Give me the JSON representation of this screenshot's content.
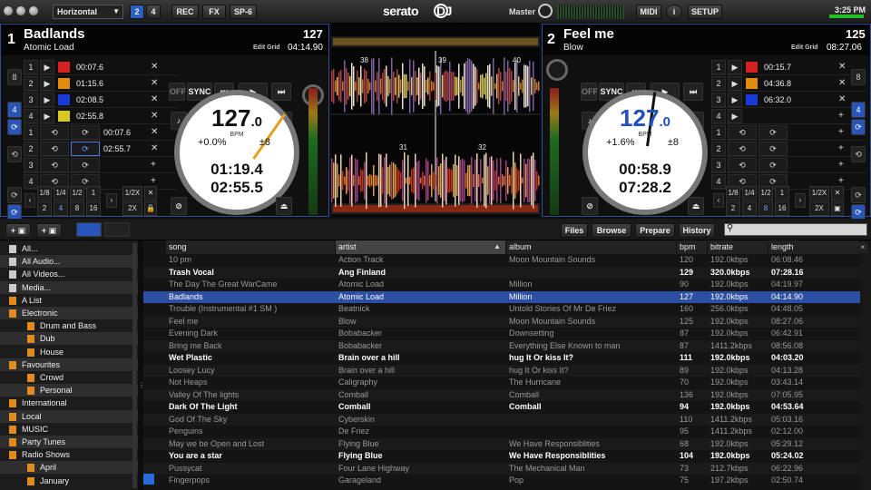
{
  "topbar": {
    "layout": "Horizontal",
    "deck_btns": [
      "2",
      "4"
    ],
    "buttons": [
      "REC",
      "FX",
      "SP-6"
    ],
    "logo": "serato",
    "logo_dj": "DJ",
    "master_label": "Master",
    "right_buttons": [
      "MIDI",
      "i",
      "SETUP"
    ],
    "clock": "3:25 PM"
  },
  "deck1": {
    "num": "1",
    "title": "Badlands",
    "artist": "Atomic Load",
    "bpm": "127",
    "time": "04:14.90",
    "edit_grid": "Edit Grid",
    "bpm_big": "127",
    "bpm_dec": ".0",
    "bpm_label": "BPM",
    "pitch": "+0.0%",
    "range": "±8",
    "elapsed": "01:19.4",
    "remain": "02:55.5",
    "side_labels": [
      "8",
      "4"
    ],
    "cues": [
      {
        "n": "1",
        "time": "00:07.6",
        "color": "#d42020"
      },
      {
        "n": "2",
        "time": "01:15.6",
        "color": "#e08a10"
      },
      {
        "n": "3",
        "time": "02:08.5",
        "color": "#1a3ad8"
      },
      {
        "n": "4",
        "time": "02:55.8",
        "color": "#d8c820"
      }
    ],
    "loops": [
      {
        "n": "1",
        "time": "00:07.6"
      },
      {
        "n": "2",
        "time": "02:55.7"
      },
      {
        "n": "3",
        "time": ""
      },
      {
        "n": "4",
        "time": ""
      }
    ],
    "controls": [
      "OFF",
      "SYNC"
    ],
    "loop_sizes_top": [
      "1/8",
      "1/4",
      "1/2",
      "1",
      "1/2X"
    ],
    "loop_sizes_bottom": [
      "2",
      "4",
      "8",
      "16",
      "2X"
    ]
  },
  "deck2": {
    "num": "2",
    "title": "Feel me",
    "artist": "Blow",
    "bpm": "125",
    "time": "08:27.06",
    "edit_grid": "Edit Grid",
    "bpm_big": "127",
    "bpm_dec": ".0",
    "bpm_label": "BPM",
    "pitch": "+1.6%",
    "range": "±8",
    "elapsed": "00:58.9",
    "remain": "07:28.2",
    "side_labels": [
      "8",
      "4"
    ],
    "cues": [
      {
        "n": "1",
        "time": "00:15.7",
        "color": "#d42020"
      },
      {
        "n": "2",
        "time": "04:36.8",
        "color": "#e08a10"
      },
      {
        "n": "3",
        "time": "06:32.0",
        "color": "#1a3ad8"
      },
      {
        "n": "4",
        "time": "",
        "color": ""
      }
    ],
    "loops": [
      {
        "n": "1",
        "time": ""
      },
      {
        "n": "2",
        "time": ""
      },
      {
        "n": "3",
        "time": ""
      },
      {
        "n": "4",
        "time": ""
      }
    ],
    "controls": [
      "OFF",
      "SYNC"
    ],
    "loop_sizes_top": [
      "1/8",
      "1/4",
      "1/2",
      "1",
      "1/2X"
    ],
    "loop_sizes_bottom": [
      "2",
      "4",
      "8",
      "16",
      "2X"
    ]
  },
  "waveform": {
    "markers": [
      "38",
      "39",
      "40",
      "31",
      "32"
    ]
  },
  "library": {
    "tabs": [
      "Files",
      "Browse",
      "Prepare",
      "History"
    ],
    "search_placeholder": "",
    "close": "×"
  },
  "sidebar": {
    "items": [
      {
        "label": "All...",
        "indent": 0,
        "icon": "gear-icon"
      },
      {
        "label": "All Audio...",
        "indent": 0,
        "icon": "audio-icon"
      },
      {
        "label": "All Videos...",
        "indent": 0,
        "icon": "video-icon"
      },
      {
        "label": "Media...",
        "indent": 0,
        "icon": "media-icon"
      },
      {
        "label": "A List",
        "indent": 0,
        "icon": "crate-icon"
      },
      {
        "label": "Electronic",
        "indent": 0,
        "icon": "crate-open-icon"
      },
      {
        "label": "Drum and Bass",
        "indent": 2,
        "icon": "crate-icon"
      },
      {
        "label": "Dub",
        "indent": 2,
        "icon": "crate-icon"
      },
      {
        "label": "House",
        "indent": 2,
        "icon": "crate-icon"
      },
      {
        "label": "Favourites",
        "indent": 0,
        "icon": "crate-open-icon"
      },
      {
        "label": "Crowd",
        "indent": 2,
        "icon": "crate-icon"
      },
      {
        "label": "Personal",
        "indent": 2,
        "icon": "crate-icon"
      },
      {
        "label": "International",
        "indent": 0,
        "icon": "crate-icon"
      },
      {
        "label": "Local",
        "indent": 0,
        "icon": "crate-icon"
      },
      {
        "label": "MUSIC",
        "indent": 0,
        "icon": "crate-icon"
      },
      {
        "label": "Party Tunes",
        "indent": 0,
        "icon": "crate-icon"
      },
      {
        "label": "Radio Shows",
        "indent": 0,
        "icon": "crate-open-icon"
      },
      {
        "label": "April",
        "indent": 2,
        "icon": "crate-icon"
      },
      {
        "label": "January",
        "indent": 2,
        "icon": "crate-icon"
      }
    ]
  },
  "table": {
    "columns": [
      "song",
      "artist",
      "album",
      "bpm",
      "bitrate",
      "length"
    ],
    "rows": [
      {
        "song": "10 pm",
        "artist": "Action Track",
        "album": "Moon Mountain Sounds",
        "bpm": "120",
        "bitrate": "192.0kbps",
        "length": "06:08.46",
        "style": ""
      },
      {
        "song": "Trash Vocal",
        "artist": "Ang Finland",
        "album": "",
        "bpm": "129",
        "bitrate": "320.0kbps",
        "length": "07:28.16",
        "style": "bold"
      },
      {
        "song": "The Day The Great WarCame",
        "artist": "Atomic Load",
        "album": "Million",
        "bpm": "90",
        "bitrate": "192.0kbps",
        "length": "04:19.97",
        "style": ""
      },
      {
        "song": "Badlands",
        "artist": "Atomic Load",
        "album": "Million",
        "bpm": "127",
        "bitrate": "192.0kbps",
        "length": "04:14.90",
        "style": "sel"
      },
      {
        "song": "Trouble (Instrumental #1 SM )",
        "artist": "Beatnick",
        "album": "Untold Stories Of Mr De Friez",
        "bpm": "160",
        "bitrate": "256.0kbps",
        "length": "04:48.05",
        "style": ""
      },
      {
        "song": "Feel me",
        "artist": "Blow",
        "album": "Moon Mountain Sounds",
        "bpm": "125",
        "bitrate": "192.0kbps",
        "length": "08:27.06",
        "style": ""
      },
      {
        "song": "Evening Dark",
        "artist": "Bobabacker",
        "album": "Downsetting",
        "bpm": "87",
        "bitrate": "192.0kbps",
        "length": "06:42.91",
        "style": ""
      },
      {
        "song": "Bring me Back",
        "artist": "Bobabacker",
        "album": "Everything Else Known to man",
        "bpm": "87",
        "bitrate": "1411.2kbps",
        "length": "08:56.08",
        "style": ""
      },
      {
        "song": "Wet Plastic",
        "artist": "Brain over a hill",
        "album": "hug It Or kiss It?",
        "bpm": "111",
        "bitrate": "192.0kbps",
        "length": "04:03.20",
        "style": "bold"
      },
      {
        "song": "Loosey Lucy",
        "artist": "Brain over a hill",
        "album": "hug It Or kiss It?",
        "bpm": "89",
        "bitrate": "192.0kbps",
        "length": "04:13.28",
        "style": ""
      },
      {
        "song": "Not Heaps",
        "artist": "Caligraphy",
        "album": "The Hurricane",
        "bpm": "70",
        "bitrate": "192.0kbps",
        "length": "03:43.14",
        "style": ""
      },
      {
        "song": "Valley Of The lights",
        "artist": "Comball",
        "album": "Comball",
        "bpm": "136",
        "bitrate": "192.0kbps",
        "length": "07:05.95",
        "style": ""
      },
      {
        "song": "Dark Of The Light",
        "artist": "Comball",
        "album": "Comball",
        "bpm": "94",
        "bitrate": "192.0kbps",
        "length": "04:53.64",
        "style": "bold"
      },
      {
        "song": "God Of The Sky",
        "artist": "Cyberskin",
        "album": "",
        "bpm": "110",
        "bitrate": "1411.2kbps",
        "length": "05:03.16",
        "style": ""
      },
      {
        "song": "Penguins",
        "artist": "De Friez",
        "album": "",
        "bpm": "95",
        "bitrate": "1411.2kbps",
        "length": "02:12.00",
        "style": ""
      },
      {
        "song": "May we be Open and Lost",
        "artist": "Flying Blue",
        "album": "We Have Responsiblities",
        "bpm": "68",
        "bitrate": "192.0kbps",
        "length": "05:29.12",
        "style": ""
      },
      {
        "song": "You are a star",
        "artist": "Flying Blue",
        "album": "We Have Responsiblities",
        "bpm": "104",
        "bitrate": "192.0kbps",
        "length": "05:24.02",
        "style": "bold"
      },
      {
        "song": "Pussycat",
        "artist": "Four Lane Highway",
        "album": "The Mechanical Man",
        "bpm": "73",
        "bitrate": "212.7kbps",
        "length": "06:22.96",
        "style": ""
      },
      {
        "song": "Fingerpops",
        "artist": "Garageland",
        "album": "Pop",
        "bpm": "75",
        "bitrate": "197.2kbps",
        "length": "02:50.74",
        "style": ""
      }
    ]
  },
  "colors": {
    "accent": "#2a55b8",
    "deck_border": "#2e4d95",
    "pitch_orange": "#e0a020",
    "pitch_blue": "#2050c0"
  }
}
